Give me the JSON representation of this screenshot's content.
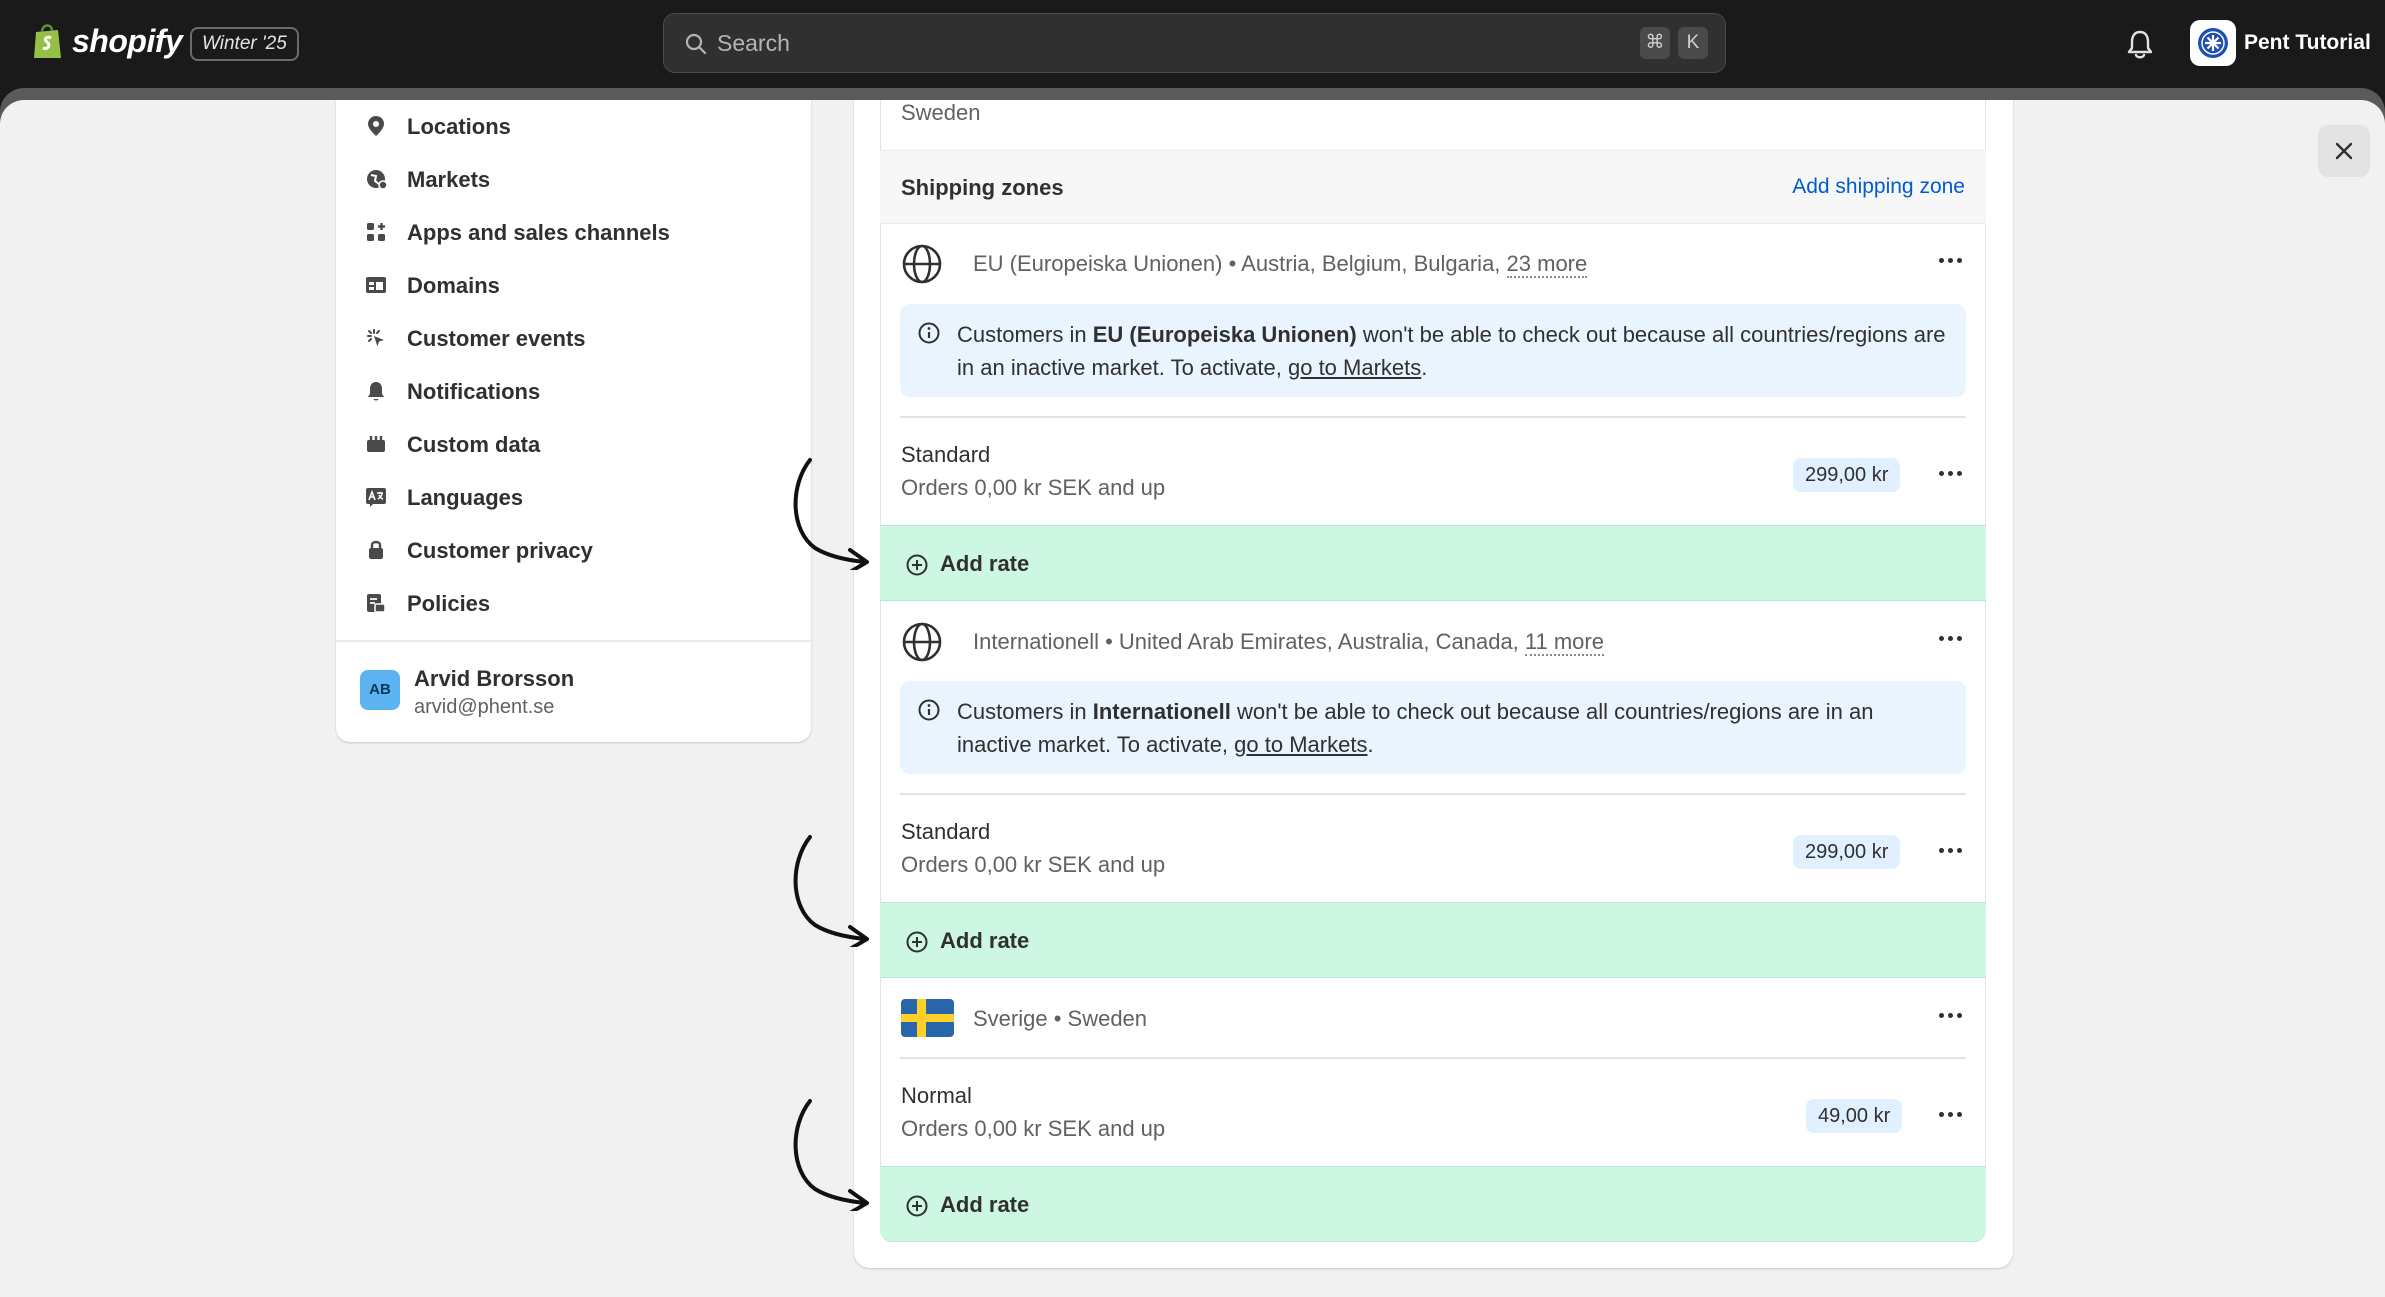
{
  "topbar": {
    "logo_text": "shopify",
    "version_badge": "Winter '25",
    "search_placeholder": "Search",
    "shortcut_cmd": "⌘",
    "shortcut_key": "K",
    "store_name": "Pent Tutorial"
  },
  "sidebar": {
    "items": [
      {
        "label": "Locations",
        "icon": "location-pin-icon"
      },
      {
        "label": "Markets",
        "icon": "globe-market-icon"
      },
      {
        "label": "Apps and sales channels",
        "icon": "apps-icon"
      },
      {
        "label": "Domains",
        "icon": "domain-icon"
      },
      {
        "label": "Customer events",
        "icon": "cursor-click-icon"
      },
      {
        "label": "Notifications",
        "icon": "bell-icon"
      },
      {
        "label": "Custom data",
        "icon": "custom-data-icon"
      },
      {
        "label": "Languages",
        "icon": "language-icon"
      },
      {
        "label": "Customer privacy",
        "icon": "lock-icon"
      },
      {
        "label": "Policies",
        "icon": "policies-icon"
      }
    ],
    "user": {
      "initials": "AB",
      "name": "Arvid Brorsson",
      "email": "arvid@phent.se"
    }
  },
  "main": {
    "origin_country": "Sweden",
    "shipping_zones_title": "Shipping zones",
    "add_shipping_zone_label": "Add shipping zone",
    "zones": [
      {
        "name": "EU (Europeiska Unionen)",
        "countries": " • Austria, Belgium, Bulgaria, ",
        "more": "23 more",
        "banner": {
          "prefix": "Customers in ",
          "zone": "EU (Europeiska Unionen)",
          "middle": " won't be able to check out because all countries/regions are in an inactive market. To activate, ",
          "link": "go to Markets",
          "suffix": "."
        },
        "rate": {
          "name": "Standard",
          "condition": "Orders 0,00 kr SEK and up",
          "price": "299,00 kr"
        },
        "add_rate_label": "Add rate"
      },
      {
        "name": "Internationell",
        "countries": " • United Arab Emirates, Australia, Canada, ",
        "more": "11 more",
        "banner": {
          "prefix": "Customers in ",
          "zone": "Internationell",
          "middle": " won't be able to check out because all countries/regions are in an inactive market. To activate, ",
          "link": "go to Markets",
          "suffix": "."
        },
        "rate": {
          "name": "Standard",
          "condition": "Orders 0,00 kr SEK and up",
          "price": "299,00 kr"
        },
        "add_rate_label": "Add rate"
      },
      {
        "name": "Sverige",
        "countries": " • Sweden",
        "rate": {
          "name": "Normal",
          "condition": "Orders 0,00 kr SEK and up",
          "price": "49,00 kr"
        },
        "add_rate_label": "Add rate"
      }
    ]
  },
  "colors": {
    "add_rate_bg": "#cdf7e3",
    "banner_bg": "#eaf4ff",
    "link": "#005bd3",
    "price_pill": "#e0f0ff"
  }
}
